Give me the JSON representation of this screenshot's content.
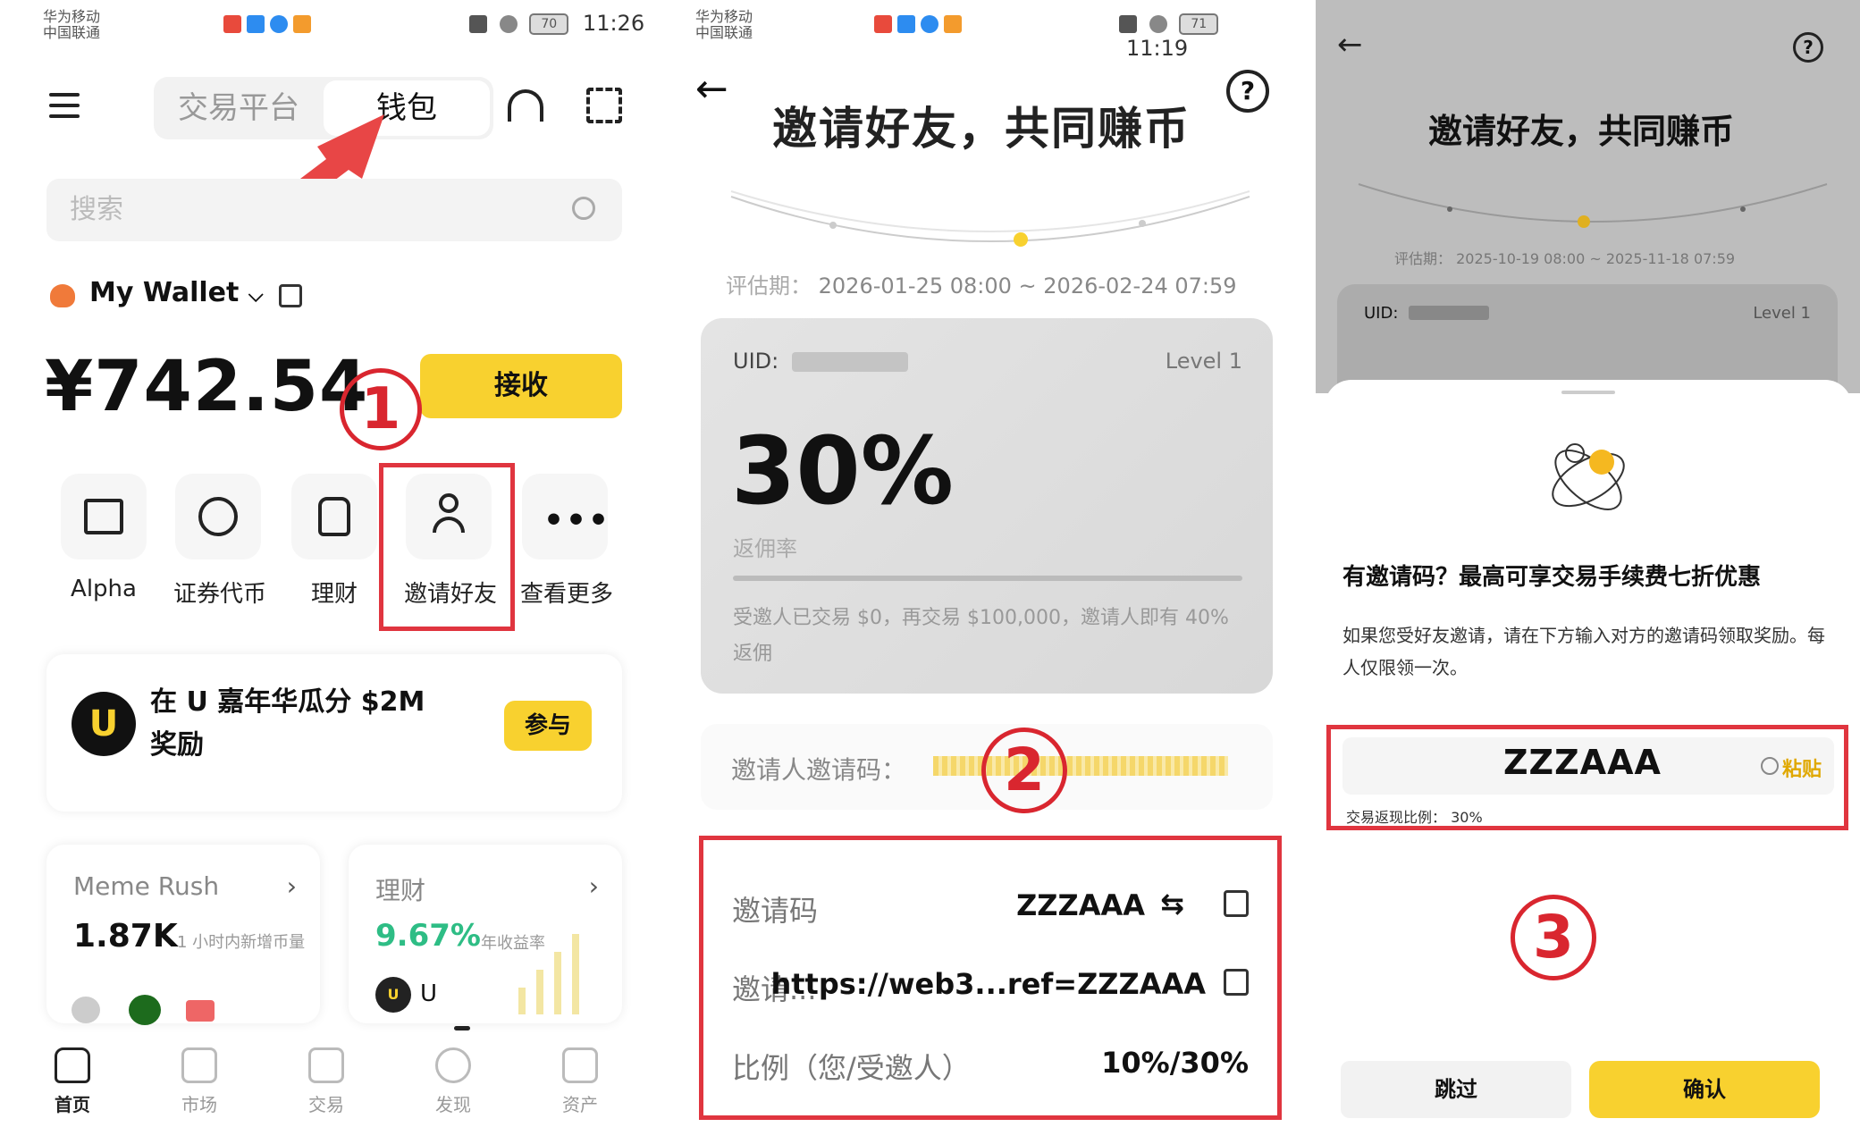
{
  "panel1": {
    "status_left_top": "华为移动",
    "status_left_bottom": "中国联通",
    "battery": "70",
    "time": "11:26",
    "tabs": [
      "交易平台",
      "钱包"
    ],
    "search_placeholder": "搜索",
    "wallet_name": "My Wallet",
    "balance": "¥742.54",
    "receive_label": "接收",
    "step_number": "1",
    "shortcuts": [
      "Alpha",
      "证券代币",
      "理财",
      "邀请好友",
      "查看更多"
    ],
    "promo_text": "在 U 嘉年华瓜分 $2M 奖励",
    "promo_badge": "U",
    "promo_button": "参与",
    "card1_title": "Meme Rush",
    "card1_value": "1.87K",
    "card1_sub": "1 小时内新增币量",
    "card2_title": "理财",
    "card2_value": "9.67%",
    "card2_sub": "年收益率",
    "card2_token": "U",
    "nav": [
      "首页",
      "市场",
      "交易",
      "发现",
      "资产"
    ],
    "accent": "#f8d12f",
    "highlight": "#e0353f"
  },
  "panel2": {
    "status_left_top": "华为移动",
    "status_left_bottom": "中国联通",
    "battery": "71",
    "time": "11:19",
    "title": "邀请好友，共同赚币",
    "period_label": "评估期：",
    "period": "2026-01-25 08:00 ~ 2026-02-24 07:59",
    "uid_label": "UID:",
    "level": "Level 1",
    "rate": "30%",
    "rate_label": "返佣率",
    "progress_text": "受邀人已交易 $0，再交易 $100,000，邀请人即有 40% 返佣",
    "referrer_label": "邀请人邀请码：",
    "step_number": "2",
    "code_label": "邀请码",
    "code_value": "ZZZAAA",
    "link_label": "邀请...",
    "link_value": "https://web3...ref=ZZZAAA",
    "ratio_label": "比例（您/受邀人）",
    "ratio_value": "10%/30%"
  },
  "panel3": {
    "title": "邀请好友，共同赚币",
    "period_label": "评估期：",
    "period": "2025-10-19 08:00 ~ 2025-11-18 07:59",
    "uid_label": "UID:",
    "level": "Level 1",
    "sheet_title": "有邀请码？最高可享交易手续费七折优惠",
    "sheet_desc": "如果您受好友邀请，请在下方输入对方的邀请码领取奖励。每人仅限领一次。",
    "code_value": "ZZZAAA",
    "paste_label": "粘贴",
    "rebate_label": "交易返现比例：",
    "rebate_value": "30%",
    "step_number": "3",
    "skip_label": "跳过",
    "confirm_label": "确认"
  }
}
